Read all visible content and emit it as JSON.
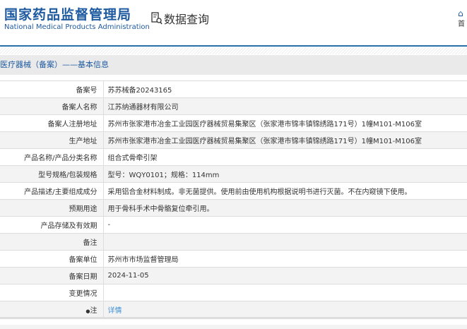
{
  "header": {
    "title_cn": "国家药品监督管理局",
    "title_en": "National Medical Products Administration",
    "data_query": "数据查询",
    "home": "首"
  },
  "breadcrumb": "医疗器械（备案）——基本信息",
  "rows": [
    {
      "label": "备案号",
      "value": "苏苏械备20243165"
    },
    {
      "label": "备案人名称",
      "value": "江苏纳通器材有限公司"
    },
    {
      "label": "备案人注册地址",
      "value": "苏州市张家港市冶金工业园医疗器械贸易集聚区（张家港市锦丰镇锦绣路171号）1幢M101-M106室"
    },
    {
      "label": "生产地址",
      "value": "苏州市张家港市冶金工业园医疗器械贸易集聚区（张家港市锦丰镇锦绣路171号）1幢M101-M106室"
    },
    {
      "label": "产品名称/产品分类名称",
      "value": "组合式骨牵引架"
    },
    {
      "label": "型号规格/包装规格",
      "value": "型号：WQY0101；规格：114mm"
    },
    {
      "label": "产品描述/主要组成成分",
      "value": "采用铝合金材料制成。非无菌提供。使用前由使用机构根据说明书进行灭菌。不在内窥镜下使用。"
    },
    {
      "label": "预期用途",
      "value": "用于骨科手术中骨骼复位牵引用。"
    },
    {
      "label": "产品存储及有效期",
      "value": "-"
    },
    {
      "label": "备注",
      "value": ""
    },
    {
      "label": "备案单位",
      "value": "苏州市市场监督管理局"
    },
    {
      "label": "备案日期",
      "value": "2024-11-05"
    },
    {
      "label": "变更情况",
      "value": ""
    },
    {
      "label": "注",
      "value": "详情"
    }
  ]
}
